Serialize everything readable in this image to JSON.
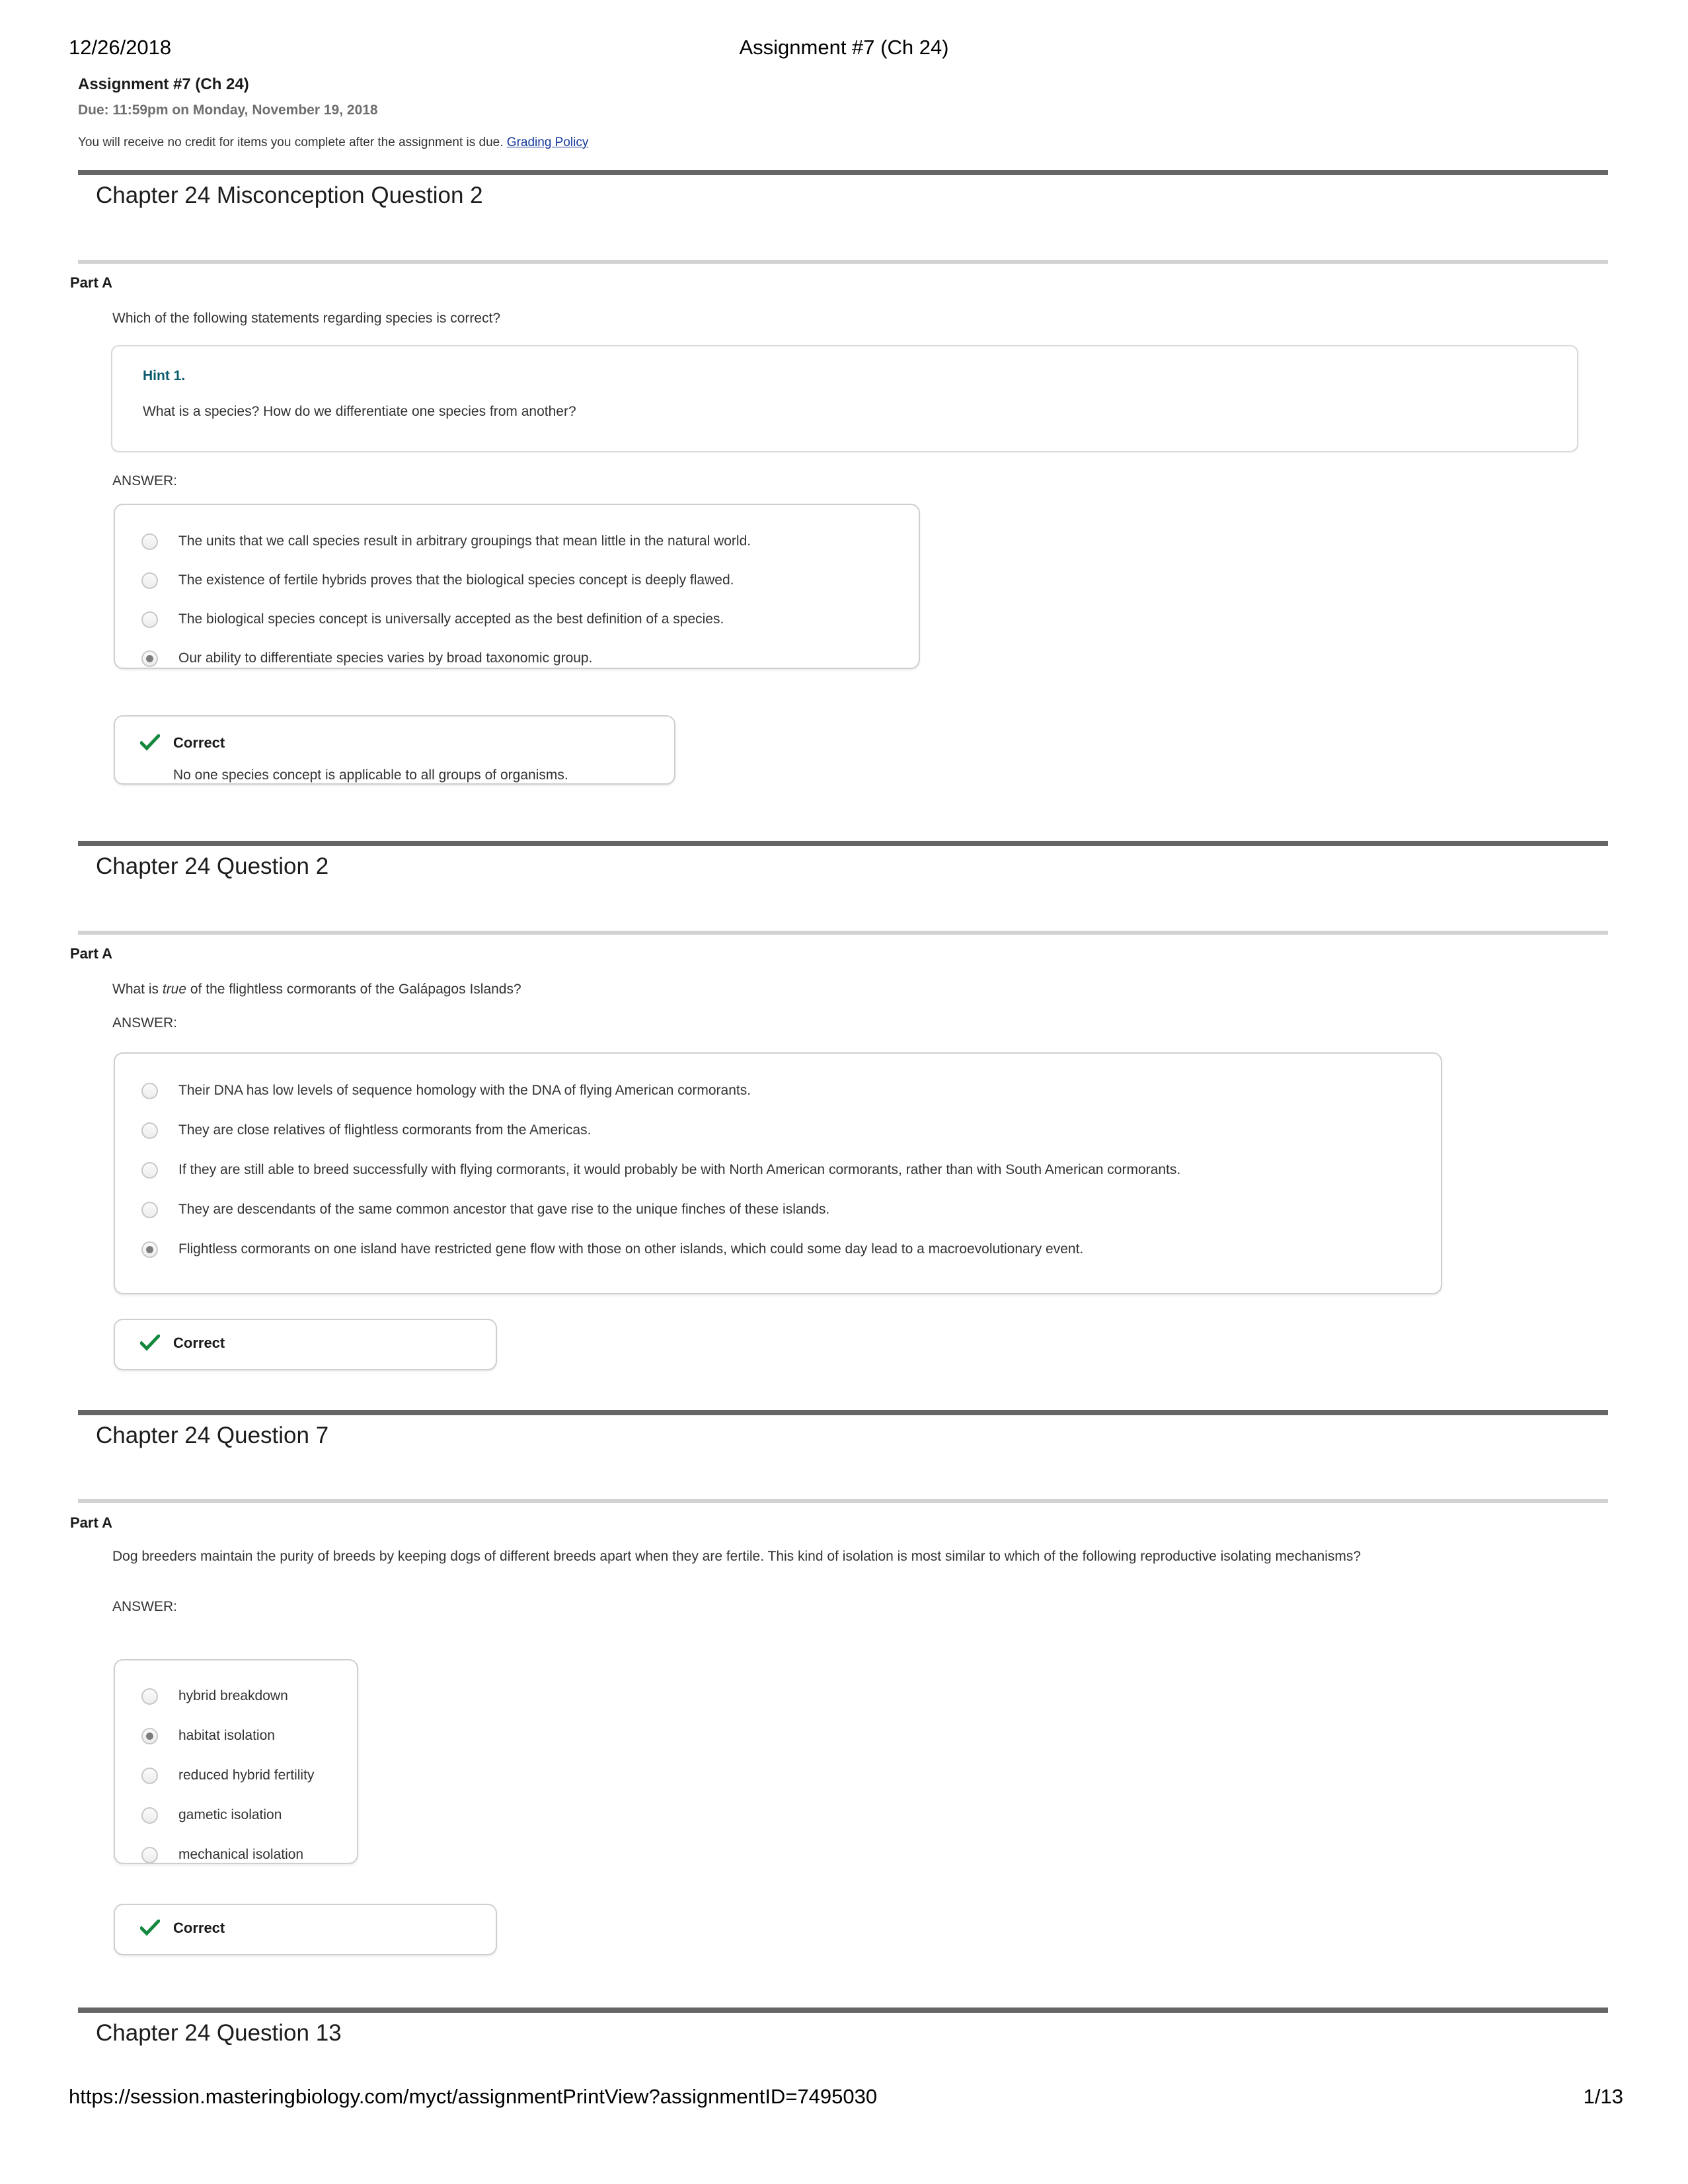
{
  "print_header": {
    "date": "12/26/2018",
    "title": "Assignment #7 (Ch 24)"
  },
  "assignment": {
    "title": "Assignment #7 (Ch 24)",
    "due": "Due: 11:59pm on Monday, November 19, 2018",
    "note_text": "You will receive no credit for items you complete after the assignment is due.",
    "grading_policy_link": "Grading Policy"
  },
  "labels": {
    "part_a": "Part A",
    "answer": "ANSWER:",
    "correct": "Correct"
  },
  "questions": [
    {
      "heading": "Chapter 24 Misconception Question 2",
      "part": "Part A",
      "prompt": "Which of the following statements regarding species is correct?",
      "hint": {
        "title": "Hint 1.",
        "body": "What is a species?  How do we differentiate one species from another?"
      },
      "answer_label": "ANSWER:",
      "choices": [
        {
          "text": "The units that we call species result in arbitrary groupings that mean little in the natural world.",
          "selected": false
        },
        {
          "text": "The existence of fertile hybrids proves that the biological species concept is deeply flawed.",
          "selected": false
        },
        {
          "text": "The biological species concept is universally accepted as the best definition of a species.",
          "selected": false
        },
        {
          "text": "Our ability to differentiate species varies by broad taxonomic group.",
          "selected": true
        }
      ],
      "feedback": {
        "status": "Correct",
        "explanation": "No one species concept is applicable to all groups of organisms."
      }
    },
    {
      "heading": "Chapter 24 Question 2",
      "part": "Part A",
      "prompt_prefix": "What is ",
      "prompt_italic": "true",
      "prompt_suffix": " of the flightless cormorants of the Galápagos Islands?",
      "answer_label": "ANSWER:",
      "choices": [
        {
          "text": "Their DNA has low levels of sequence homology with the DNA of flying American cormorants.",
          "selected": false
        },
        {
          "text": "They are close relatives of flightless cormorants from the Americas.",
          "selected": false
        },
        {
          "text": "If they are still able to breed successfully with flying cormorants, it would probably be with North American cormorants, rather than with South American cormorants.",
          "selected": false
        },
        {
          "text": "They are descendants of the same common ancestor that gave rise to the unique finches of these islands.",
          "selected": false
        },
        {
          "text": "Flightless cormorants on one island have restricted gene flow with those on other islands, which could some day lead to a macroevolutionary event.",
          "selected": true
        }
      ],
      "feedback": {
        "status": "Correct",
        "explanation": ""
      }
    },
    {
      "heading": "Chapter 24 Question 7",
      "part": "Part A",
      "prompt_line1": "Dog breeders maintain the purity of breeds by keeping dogs of different breeds apart when they are fertile. This kind of isolation is most similar to which of the following reproductive isolating",
      "prompt_line2": "mechanisms?",
      "answer_label": "ANSWER:",
      "choices": [
        {
          "text": "hybrid breakdown",
          "selected": false
        },
        {
          "text": "habitat isolation",
          "selected": true
        },
        {
          "text": "reduced hybrid fertility",
          "selected": false
        },
        {
          "text": "gametic isolation",
          "selected": false
        },
        {
          "text": "mechanical isolation",
          "selected": false
        }
      ],
      "feedback": {
        "status": "Correct",
        "explanation": ""
      }
    },
    {
      "heading": "Chapter 24 Question 13"
    }
  ],
  "footer": {
    "url": "https://session.masteringbiology.com/myct/assignmentPrintView?assignmentID=7495030",
    "page": "1/13"
  },
  "colors": {
    "hint_accent": "#0c5c6e",
    "correct_check": "#14883f",
    "link": "#14389c",
    "rule_dark": "#666666",
    "rule_light": "#d2d2d2"
  },
  "icons": {
    "check": "check-icon"
  }
}
